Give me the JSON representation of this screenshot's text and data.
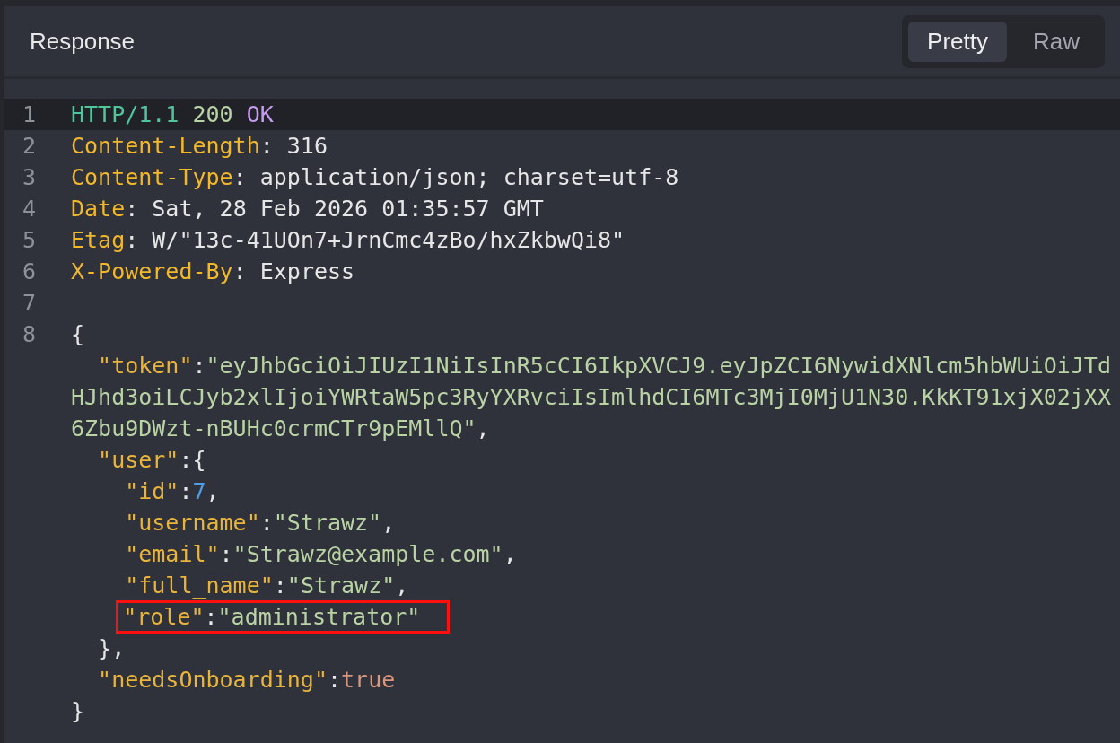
{
  "panel": {
    "title": "Response",
    "view_tabs": [
      {
        "label": "Pretty",
        "selected": true
      },
      {
        "label": "Raw",
        "selected": false
      }
    ]
  },
  "lines": [
    {
      "number": "1",
      "current": true,
      "boxed": false,
      "tokens": [
        {
          "kind": "protocol",
          "text": "HTTP/1.1 "
        },
        {
          "kind": "status",
          "text": "200 "
        },
        {
          "kind": "reason",
          "text": "OK"
        }
      ]
    },
    {
      "number": "2",
      "current": false,
      "boxed": false,
      "tokens": [
        {
          "kind": "header",
          "text": "Content-Length"
        },
        {
          "kind": "plain",
          "text": ": 316"
        }
      ]
    },
    {
      "number": "3",
      "current": false,
      "boxed": false,
      "tokens": [
        {
          "kind": "header",
          "text": "Content-Type"
        },
        {
          "kind": "plain",
          "text": ": application/json; charset=utf-8"
        }
      ]
    },
    {
      "number": "4",
      "current": false,
      "boxed": false,
      "tokens": [
        {
          "kind": "header",
          "text": "Date"
        },
        {
          "kind": "plain",
          "text": ": Sat, 28 Feb 2026 01:35:57 GMT"
        }
      ]
    },
    {
      "number": "5",
      "current": false,
      "boxed": false,
      "tokens": [
        {
          "kind": "header",
          "text": "Etag"
        },
        {
          "kind": "plain",
          "text": ": W/\"13c-41UOn7+JrnCmc4zBo/hxZkbwQi8\""
        }
      ]
    },
    {
      "number": "6",
      "current": false,
      "boxed": false,
      "tokens": [
        {
          "kind": "header",
          "text": "X-Powered-By"
        },
        {
          "kind": "plain",
          "text": ": Express"
        }
      ]
    },
    {
      "number": "7",
      "current": false,
      "boxed": false
    },
    {
      "number": "8",
      "current": false,
      "boxed": false,
      "tokens": [
        {
          "kind": "plain",
          "text": "{"
        }
      ]
    },
    {
      "current": false,
      "boxed": false,
      "tokens": [
        {
          "kind": "key",
          "text": "  \"token\""
        },
        {
          "kind": "plain",
          "text": ":"
        },
        {
          "kind": "string",
          "text": "\"eyJhbGciOiJIUzI1NiIsInR5cCI6IkpXVCJ9.eyJpZCI6NywidXNlcm5hbWUiOiJTd"
        }
      ]
    },
    {
      "current": false,
      "boxed": false,
      "tokens": [
        {
          "kind": "string",
          "text": "HJhd3oiLCJyb2xlIjoiYWRtaW5pc3RyYXRvciIsImlhdCI6MTc3MjI0MjU1N30.KkKT91xjX02jXX"
        }
      ]
    },
    {
      "current": false,
      "boxed": false,
      "tokens": [
        {
          "kind": "string",
          "text": "6Zbu9DWzt-nBUHc0crmCTr9pEMllQ\""
        },
        {
          "kind": "plain",
          "text": ","
        }
      ]
    },
    {
      "current": false,
      "boxed": false,
      "tokens": [
        {
          "kind": "key",
          "text": "  \"user\""
        },
        {
          "kind": "plain",
          "text": ":{"
        }
      ]
    },
    {
      "current": false,
      "boxed": false,
      "tokens": [
        {
          "kind": "key",
          "text": "    \"id\""
        },
        {
          "kind": "plain",
          "text": ":"
        },
        {
          "kind": "number",
          "text": "7"
        },
        {
          "kind": "plain",
          "text": ","
        }
      ]
    },
    {
      "current": false,
      "boxed": false,
      "tokens": [
        {
          "kind": "key",
          "text": "    \"username\""
        },
        {
          "kind": "plain",
          "text": ":"
        },
        {
          "kind": "string",
          "text": "\"Strawz\""
        },
        {
          "kind": "plain",
          "text": ","
        }
      ]
    },
    {
      "current": false,
      "boxed": false,
      "tokens": [
        {
          "kind": "key",
          "text": "    \"email\""
        },
        {
          "kind": "plain",
          "text": ":"
        },
        {
          "kind": "string",
          "text": "\"Strawz@example.com\""
        },
        {
          "kind": "plain",
          "text": ","
        }
      ]
    },
    {
      "current": false,
      "boxed": false,
      "tokens": [
        {
          "kind": "key",
          "text": "    \"full_name\""
        },
        {
          "kind": "plain",
          "text": ":"
        },
        {
          "kind": "string",
          "text": "\"Strawz\""
        },
        {
          "kind": "plain",
          "text": ","
        }
      ]
    },
    {
      "current": false,
      "boxed": true,
      "tokens": [
        {
          "kind": "key",
          "text": "    \"role\""
        },
        {
          "kind": "plain",
          "text": ":"
        },
        {
          "kind": "string",
          "text": "\"administrator\""
        }
      ]
    },
    {
      "current": false,
      "boxed": false,
      "tokens": [
        {
          "kind": "plain",
          "text": "  },"
        }
      ]
    },
    {
      "current": false,
      "boxed": false,
      "tokens": [
        {
          "kind": "key",
          "text": "  \"needsOnboarding\""
        },
        {
          "kind": "plain",
          "text": ":"
        },
        {
          "kind": "boolean",
          "text": "true"
        }
      ]
    },
    {
      "current": false,
      "boxed": false,
      "tokens": [
        {
          "kind": "plain",
          "text": "}"
        }
      ]
    }
  ]
}
